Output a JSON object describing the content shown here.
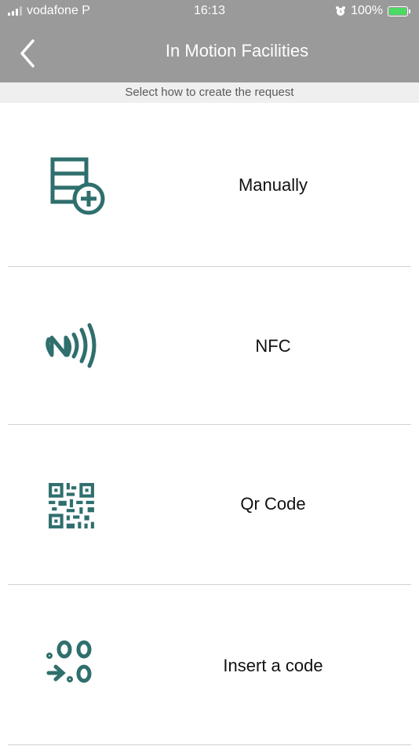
{
  "status_bar": {
    "carrier": "vodafone P",
    "time": "16:13",
    "battery_percent": "100%",
    "battery_level": 1.0
  },
  "nav": {
    "title": "In Motion Facilities",
    "back_icon": "chevron-left-icon"
  },
  "subheader": "Select how to create the request",
  "options": [
    {
      "label": "Manually",
      "icon": "table-add-icon"
    },
    {
      "label": "NFC",
      "icon": "nfc-icon"
    },
    {
      "label": "Qr Code",
      "icon": "qr-code-icon"
    },
    {
      "label": "Insert a code",
      "icon": "insert-code-icon"
    }
  ],
  "colors": {
    "header_bg": "#9a9a9a",
    "icon_teal": "#2f6f6d",
    "subheader_bg": "#efefef"
  }
}
